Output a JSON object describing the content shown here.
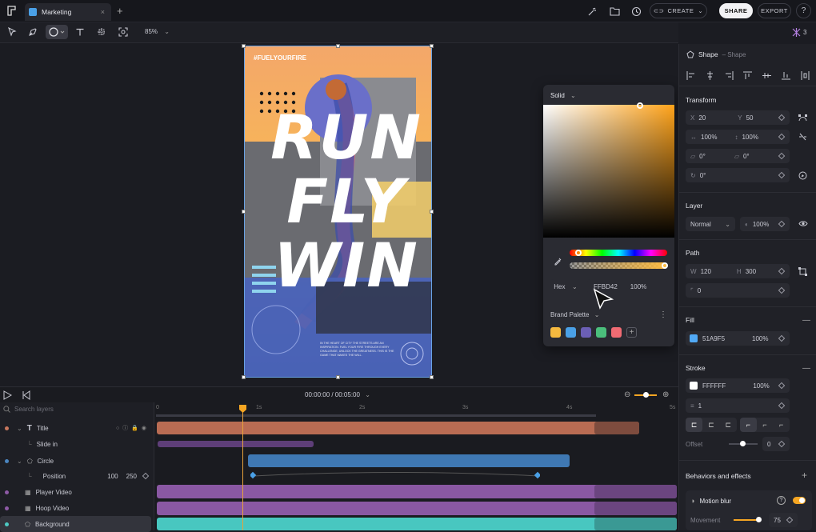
{
  "app": {
    "tab_label": "Marketing",
    "buttons": {
      "create": "CREATE",
      "share": "SHARE",
      "export": "EXPORT",
      "help": "?"
    }
  },
  "toolbar": {
    "zoom": "85%",
    "presence_count": "3"
  },
  "poster": {
    "hashtag": "#FUELYOURFIRE",
    "words": [
      "RUN",
      "FLY",
      "WIN"
    ],
    "body_text": "IN THE HEART OF CITY THE STREETS ARE AN INSPIRATION. FUEL YOUR FIRE THROUGH EVERY CHALLENGE, UNLOCK THE GREATNESS. THIS IS THE GAME THAT MAKES THE WILL."
  },
  "color_picker": {
    "mode": "Solid",
    "format": "Hex",
    "hex": "FFBD42",
    "opacity": "100%",
    "palette_label": "Brand Palette",
    "swatches": [
      "#f5b93f",
      "#4aa0e6",
      "#6b5fb5",
      "#4bbf7c",
      "#f06b73"
    ]
  },
  "right_panel": {
    "element_name": "Shape",
    "element_type": "– Shape",
    "transform": {
      "title": "Transform",
      "x_label": "X",
      "x": "20",
      "y_label": "Y",
      "y": "50",
      "width_pct": "100%",
      "height_pct": "100%",
      "skew_x": "0°",
      "skew_y": "0°",
      "rotation": "0°"
    },
    "layer": {
      "title": "Layer",
      "blend": "Normal",
      "opacity": "100%"
    },
    "path": {
      "title": "Path",
      "w_label": "W",
      "w": "120",
      "h_label": "H",
      "h": "300",
      "corner": "0"
    },
    "fill": {
      "title": "Fill",
      "hex": "51A9F5",
      "opacity": "100%",
      "color": "#51a9f5"
    },
    "stroke": {
      "title": "Stroke",
      "hex": "FFFFFF",
      "opacity": "100%",
      "width": "1",
      "offset_label": "Offset",
      "offset": "0"
    },
    "behaviors": {
      "title": "Behaviors and effects",
      "motion_blur": "Motion blur",
      "movement_label": "Movement",
      "movement": "75"
    }
  },
  "timeline": {
    "time": "00:00:00 / 00:05:00",
    "search_placeholder": "Search layers",
    "ruler": [
      "0",
      "1s",
      "2s",
      "3s",
      "4s",
      "5s"
    ],
    "layers": [
      {
        "name": "Title",
        "color": "#c8775e"
      },
      {
        "name": "Slide in",
        "color": "#6e4a8a"
      },
      {
        "name": "Circle",
        "color": "#4b86c0"
      },
      {
        "name": "Position",
        "color": "#4b86c0",
        "v1": "100",
        "v2": "250"
      },
      {
        "name": "Player Video",
        "color": "#8e5aa6"
      },
      {
        "name": "Hoop Video",
        "color": "#8e5aa6"
      },
      {
        "name": "Background",
        "color": "#4ec9c3"
      }
    ]
  }
}
